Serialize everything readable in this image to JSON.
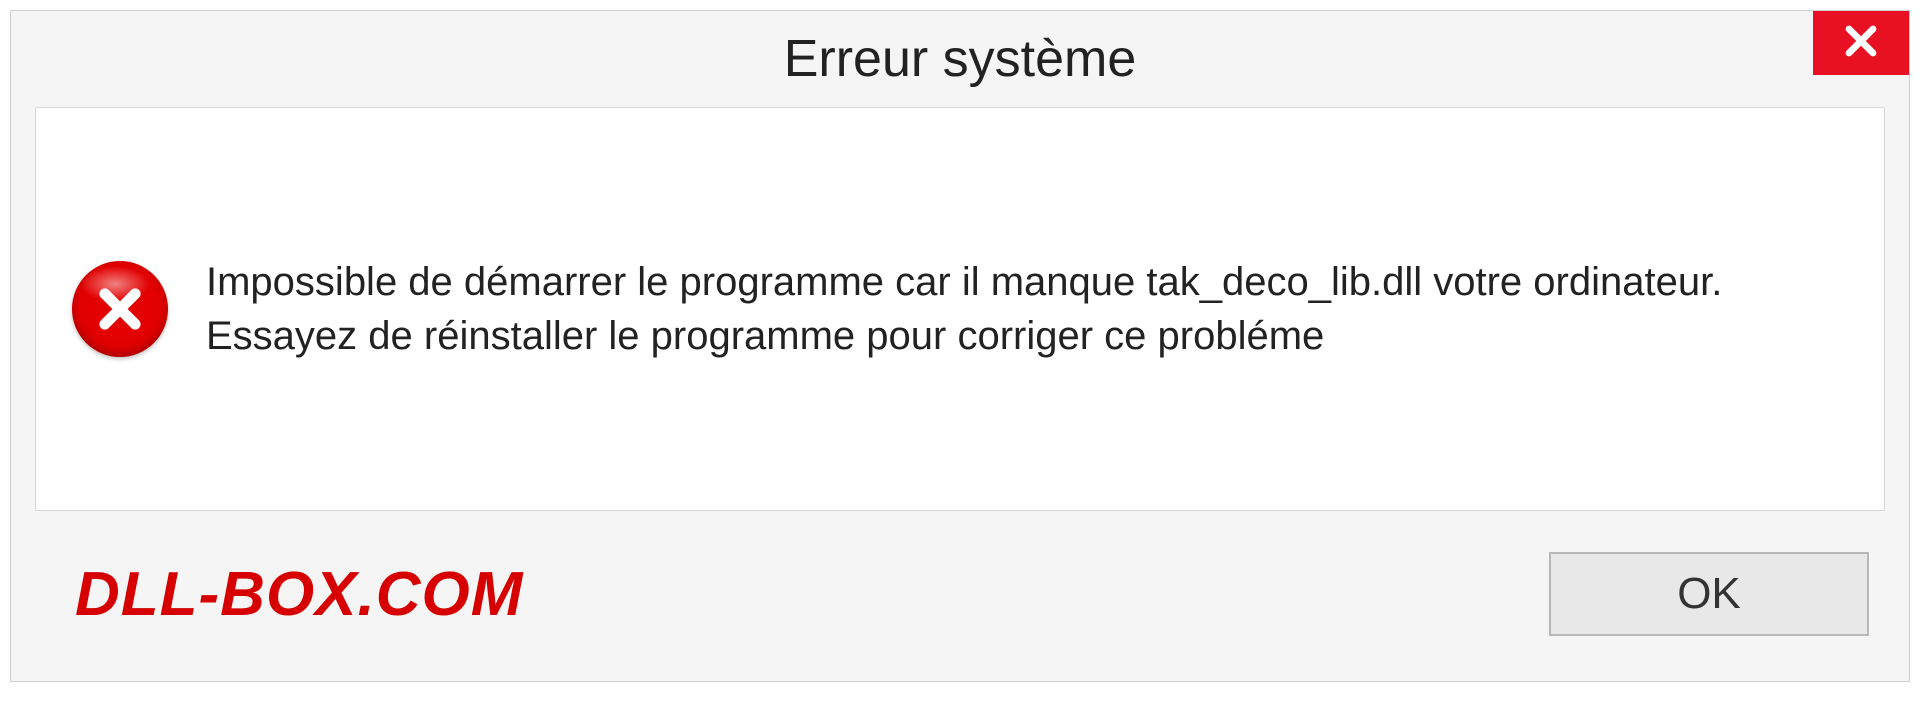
{
  "dialog": {
    "title": "Erreur système",
    "message": "Impossible de démarrer le programme car il manque tak_deco_lib.dll votre ordinateur. Essayez de réinstaller le programme pour corriger ce probléme",
    "branding": "DLL-BOX.COM",
    "ok_label": "OK"
  }
}
